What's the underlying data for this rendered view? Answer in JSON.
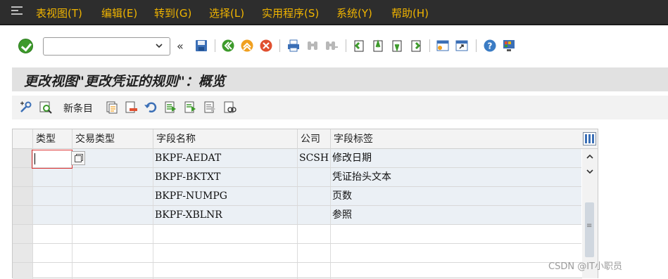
{
  "menubar": {
    "items": [
      {
        "label": "表视图(T)"
      },
      {
        "label": "编辑(E)"
      },
      {
        "label": "转到(G)"
      },
      {
        "label": "选择(L)"
      },
      {
        "label": "实用程序(S)"
      },
      {
        "label": "系统(Y)"
      },
      {
        "label": "帮助(H)"
      }
    ]
  },
  "toolbar": {
    "command_value": "",
    "icons": [
      "enter-icon",
      "back-icon",
      "save-icon",
      "exit-icon",
      "cancel-icon",
      "print-icon",
      "find-icon",
      "find-next-icon",
      "first-page-icon",
      "previous-page-icon",
      "next-page-icon",
      "last-page-icon",
      "create-session-icon",
      "shortcut-icon",
      "help-icon",
      "customize-layout-icon"
    ]
  },
  "title": {
    "text": "更改视图\"更改凭证的规则\"：概览"
  },
  "app_toolbar": {
    "new_entries_label": "新条目"
  },
  "table": {
    "columns": [
      "类型",
      "交易类型",
      "字段名称",
      "公司",
      "字段标签"
    ],
    "rows": [
      {
        "type": "",
        "trans_type": "",
        "field": "BKPF-AEDAT",
        "company": "SCSH",
        "label": "修改日期"
      },
      {
        "type": "",
        "trans_type": "",
        "field": "BKPF-BKTXT",
        "company": "",
        "label": "凭证抬头文本"
      },
      {
        "type": "",
        "trans_type": "",
        "field": "BKPF-NUMPG",
        "company": "",
        "label": "页数"
      },
      {
        "type": "",
        "trans_type": "",
        "field": "BKPF-XBLNR",
        "company": "",
        "label": "参照"
      }
    ]
  },
  "watermark": "CSDN @IT小职员",
  "colors": {
    "menubar_bg": "#2d2d2d",
    "menu_text": "#f0b400",
    "title_bg": "#e1e1e1",
    "grid_header_bg": "#f3f3f3",
    "row_fill": "#ebf0f5"
  }
}
